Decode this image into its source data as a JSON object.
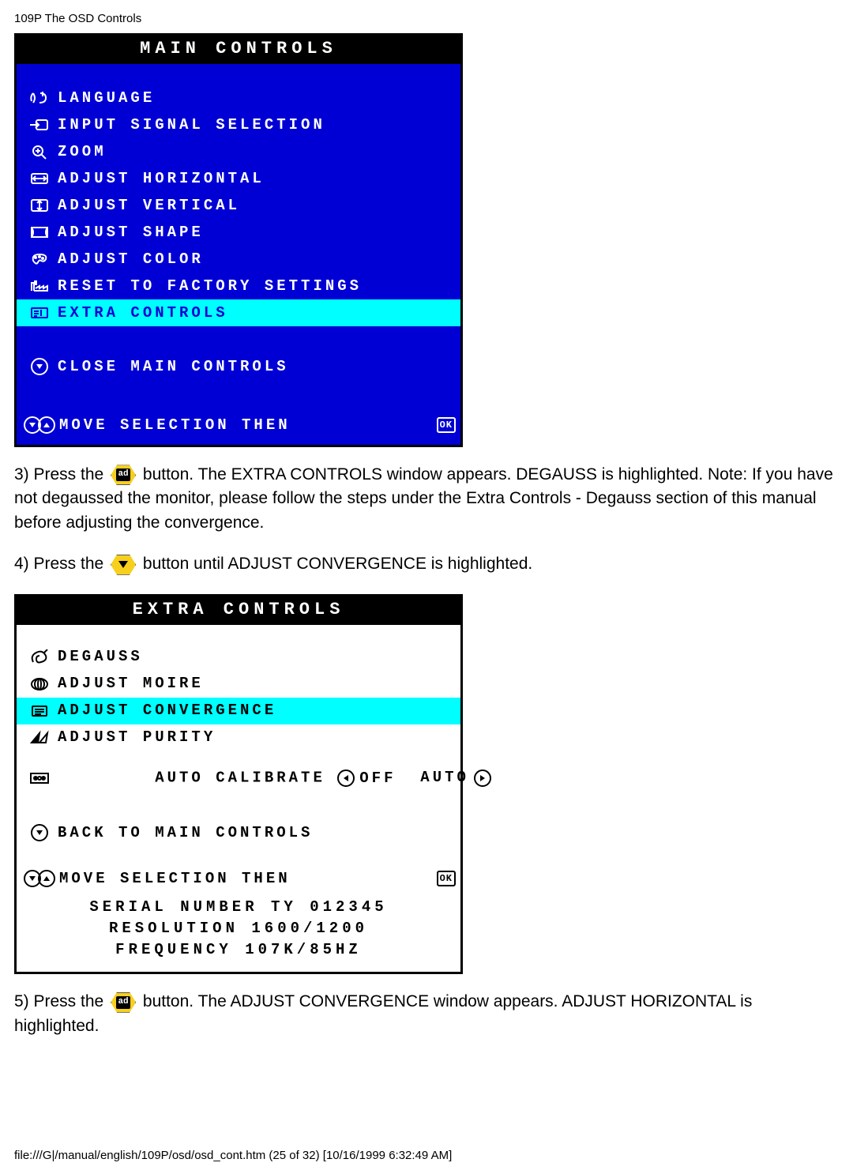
{
  "page_header": "109P The OSD Controls",
  "main_osd": {
    "title": "MAIN CONTROLS",
    "items": [
      "LANGUAGE",
      "INPUT SIGNAL SELECTION",
      "ZOOM",
      "ADJUST HORIZONTAL",
      "ADJUST VERTICAL",
      "ADJUST SHAPE",
      "ADJUST COLOR",
      "RESET TO FACTORY SETTINGS",
      "EXTRA CONTROLS"
    ],
    "close": "CLOSE MAIN CONTROLS",
    "hint_pre": "MOVE SELECTION THEN",
    "hint_ok": "OK"
  },
  "step3_a": "3) Press the ",
  "step3_b": " button. The EXTRA CONTROLS window appears. DEGAUSS is highlighted. Note: If you have not degaussed the monitor, please follow the steps under the Extra Controls - Degauss section of this manual before adjusting the convergence.",
  "step4_a": "4) Press the ",
  "step4_b": " button until ADJUST CONVERGENCE is highlighted.",
  "extra_osd": {
    "title": "EXTRA CONTROLS",
    "items": [
      "DEGAUSS",
      "ADJUST MOIRE",
      "ADJUST CONVERGENCE",
      "ADJUST PURITY"
    ],
    "auto_label": "AUTO CALIBRATE",
    "auto_off": "OFF",
    "auto_auto": "AUTO",
    "back": "BACK TO MAIN CONTROLS",
    "hint_pre": "MOVE SELECTION THEN",
    "hint_ok": "OK",
    "serial": "SERIAL NUMBER TY 012345",
    "resolution": "RESOLUTION 1600/1200",
    "frequency": "FREQUENCY 107K/85HZ"
  },
  "step5_a": "5) Press the ",
  "step5_b": " button. The ADJUST CONVERGENCE window appears. ADJUST HORIZONTAL is highlighted.",
  "footer": "file:///G|/manual/english/109P/osd/osd_cont.htm (25 of 32) [10/16/1999 6:32:49 AM]"
}
